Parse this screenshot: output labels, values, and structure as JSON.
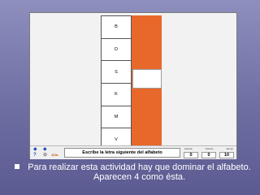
{
  "letters": [
    "B",
    "D",
    "S",
    "K",
    "M",
    "V"
  ],
  "instruction": "Escribe la letra siguiente del alfabeto",
  "score": {
    "labels": [
      "aciertos",
      "intentos",
      "tiempo"
    ],
    "values": [
      "0",
      "0",
      "10"
    ]
  },
  "nav": {
    "help_icon": "?",
    "exit_icon": "⊖",
    "prev_icon": "◆",
    "next_icon": "◆",
    "jclic_icon": "JClic"
  },
  "caption": "Para realizar esta actividad hay que dominar el alfabeto. Aparecen 4 como ésta.",
  "colors": {
    "accent": "#e8682b",
    "slide_bg": "#7373a8"
  }
}
